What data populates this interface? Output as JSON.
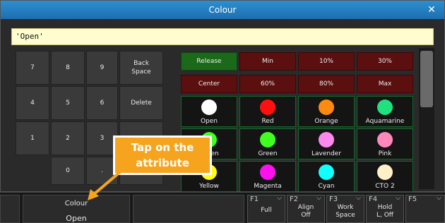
{
  "window": {
    "title": "Colour",
    "close_icon": "close-icon"
  },
  "input": {
    "value": "'Open'"
  },
  "keypad": {
    "keys": [
      "7",
      "8",
      "9",
      "Back\nSpace",
      "4",
      "5",
      "6",
      "Delete",
      "1",
      "2",
      "3",
      "",
      "0",
      "."
    ]
  },
  "top_buttons": {
    "row1": [
      "Release",
      "Min",
      "10%",
      "30%"
    ],
    "row2": [
      "Center",
      "60%",
      "80%",
      "Max"
    ]
  },
  "colours": [
    {
      "label": "Open",
      "color": "#ffffff"
    },
    {
      "label": "Red",
      "color": "#ff1010"
    },
    {
      "label": "Orange",
      "color": "#ff8a10"
    },
    {
      "label": "Aquamarine",
      "color": "#20e080"
    },
    {
      "label": "Green",
      "color": "#40ff20"
    },
    {
      "label": "Green",
      "color": "#40ff20"
    },
    {
      "label": "Lavender",
      "color": "#ff88ee"
    },
    {
      "label": "Pink",
      "color": "#ff88bb"
    },
    {
      "label": "Yellow",
      "color": "#ffff10"
    },
    {
      "label": "Magenta",
      "color": "#ff10ee"
    },
    {
      "label": "Cyan",
      "color": "#10ffff"
    },
    {
      "label": "CTO 2",
      "color": "#fff0c8"
    }
  ],
  "bottom": {
    "colour_title": "Colour",
    "colour_value": "Open"
  },
  "fkeys": [
    {
      "num": "F1",
      "label": "Full"
    },
    {
      "num": "F2",
      "label": "Align\nOff"
    },
    {
      "num": "F3",
      "label": "Work\nSpace"
    },
    {
      "num": "F4",
      "label": "Hold\nL, Off"
    },
    {
      "num": "F5",
      "label": ""
    }
  ],
  "callout": {
    "text": "Tap on the attribute"
  },
  "colors": {
    "title_blue": "#1d6fb0",
    "input_yellow": "#fffdd0",
    "release_green": "#1a6a1a",
    "preset_red": "#5b0f0f",
    "callout_orange": "#f6a41e"
  }
}
